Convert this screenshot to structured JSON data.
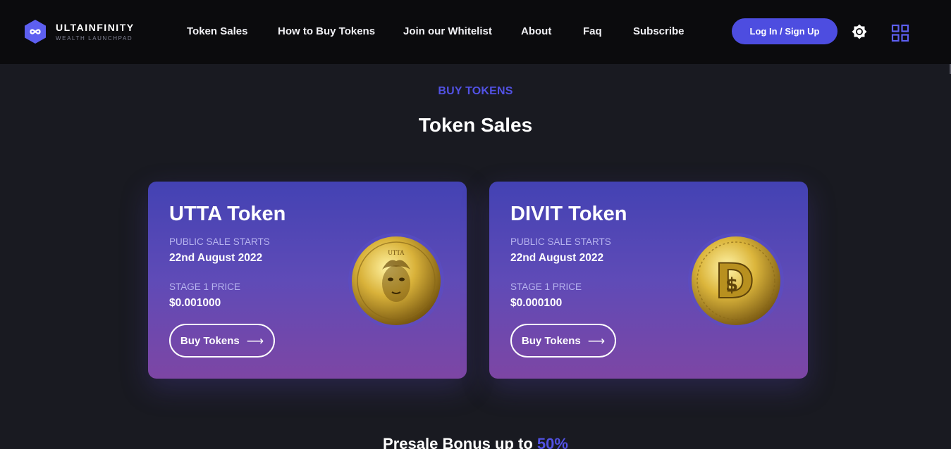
{
  "brand": {
    "name": "ULTAINFINITY",
    "tagline": "WEALTH LAUNCHPAD",
    "logo_icon": "infinity-hexagon-icon",
    "color": "#5d5ff0"
  },
  "nav": {
    "items": [
      {
        "label": "Token Sales"
      },
      {
        "label": "How to Buy Tokens"
      },
      {
        "label": "Join our Whitelist"
      },
      {
        "label": "About"
      },
      {
        "label": "Faq"
      },
      {
        "label": "Subscribe"
      }
    ],
    "login_label": "Log In / Sign Up",
    "theme_icon": "sun-icon",
    "apps_icon": "grid-icon"
  },
  "section": {
    "eyebrow": "BUY TOKENS",
    "title": "Token Sales"
  },
  "cards": [
    {
      "title": "UTTA Token",
      "start_label": "PUBLIC SALE STARTS",
      "start_date": "22nd August 2022",
      "price_label": "STAGE 1 PRICE",
      "price": "$0.001000",
      "button_label": "Buy Tokens",
      "coin_icon": "utta-coin-icon",
      "coin_text": "UTTA"
    },
    {
      "title": "DIVIT Token",
      "start_label": "PUBLIC SALE STARTS",
      "start_date": "22nd August 2022",
      "price_label": "STAGE 1 PRICE",
      "price": "$0.000100",
      "button_label": "Buy Tokens",
      "coin_icon": "divit-coin-icon",
      "coin_text": "D"
    }
  ],
  "bonus": {
    "text": "Presale Bonus up to",
    "value": "50%"
  },
  "colors": {
    "accent": "#5252e4",
    "background": "#191a21",
    "header": "#0b0b0d",
    "card_top": "#4342b3",
    "card_bottom": "#7d46a4"
  }
}
